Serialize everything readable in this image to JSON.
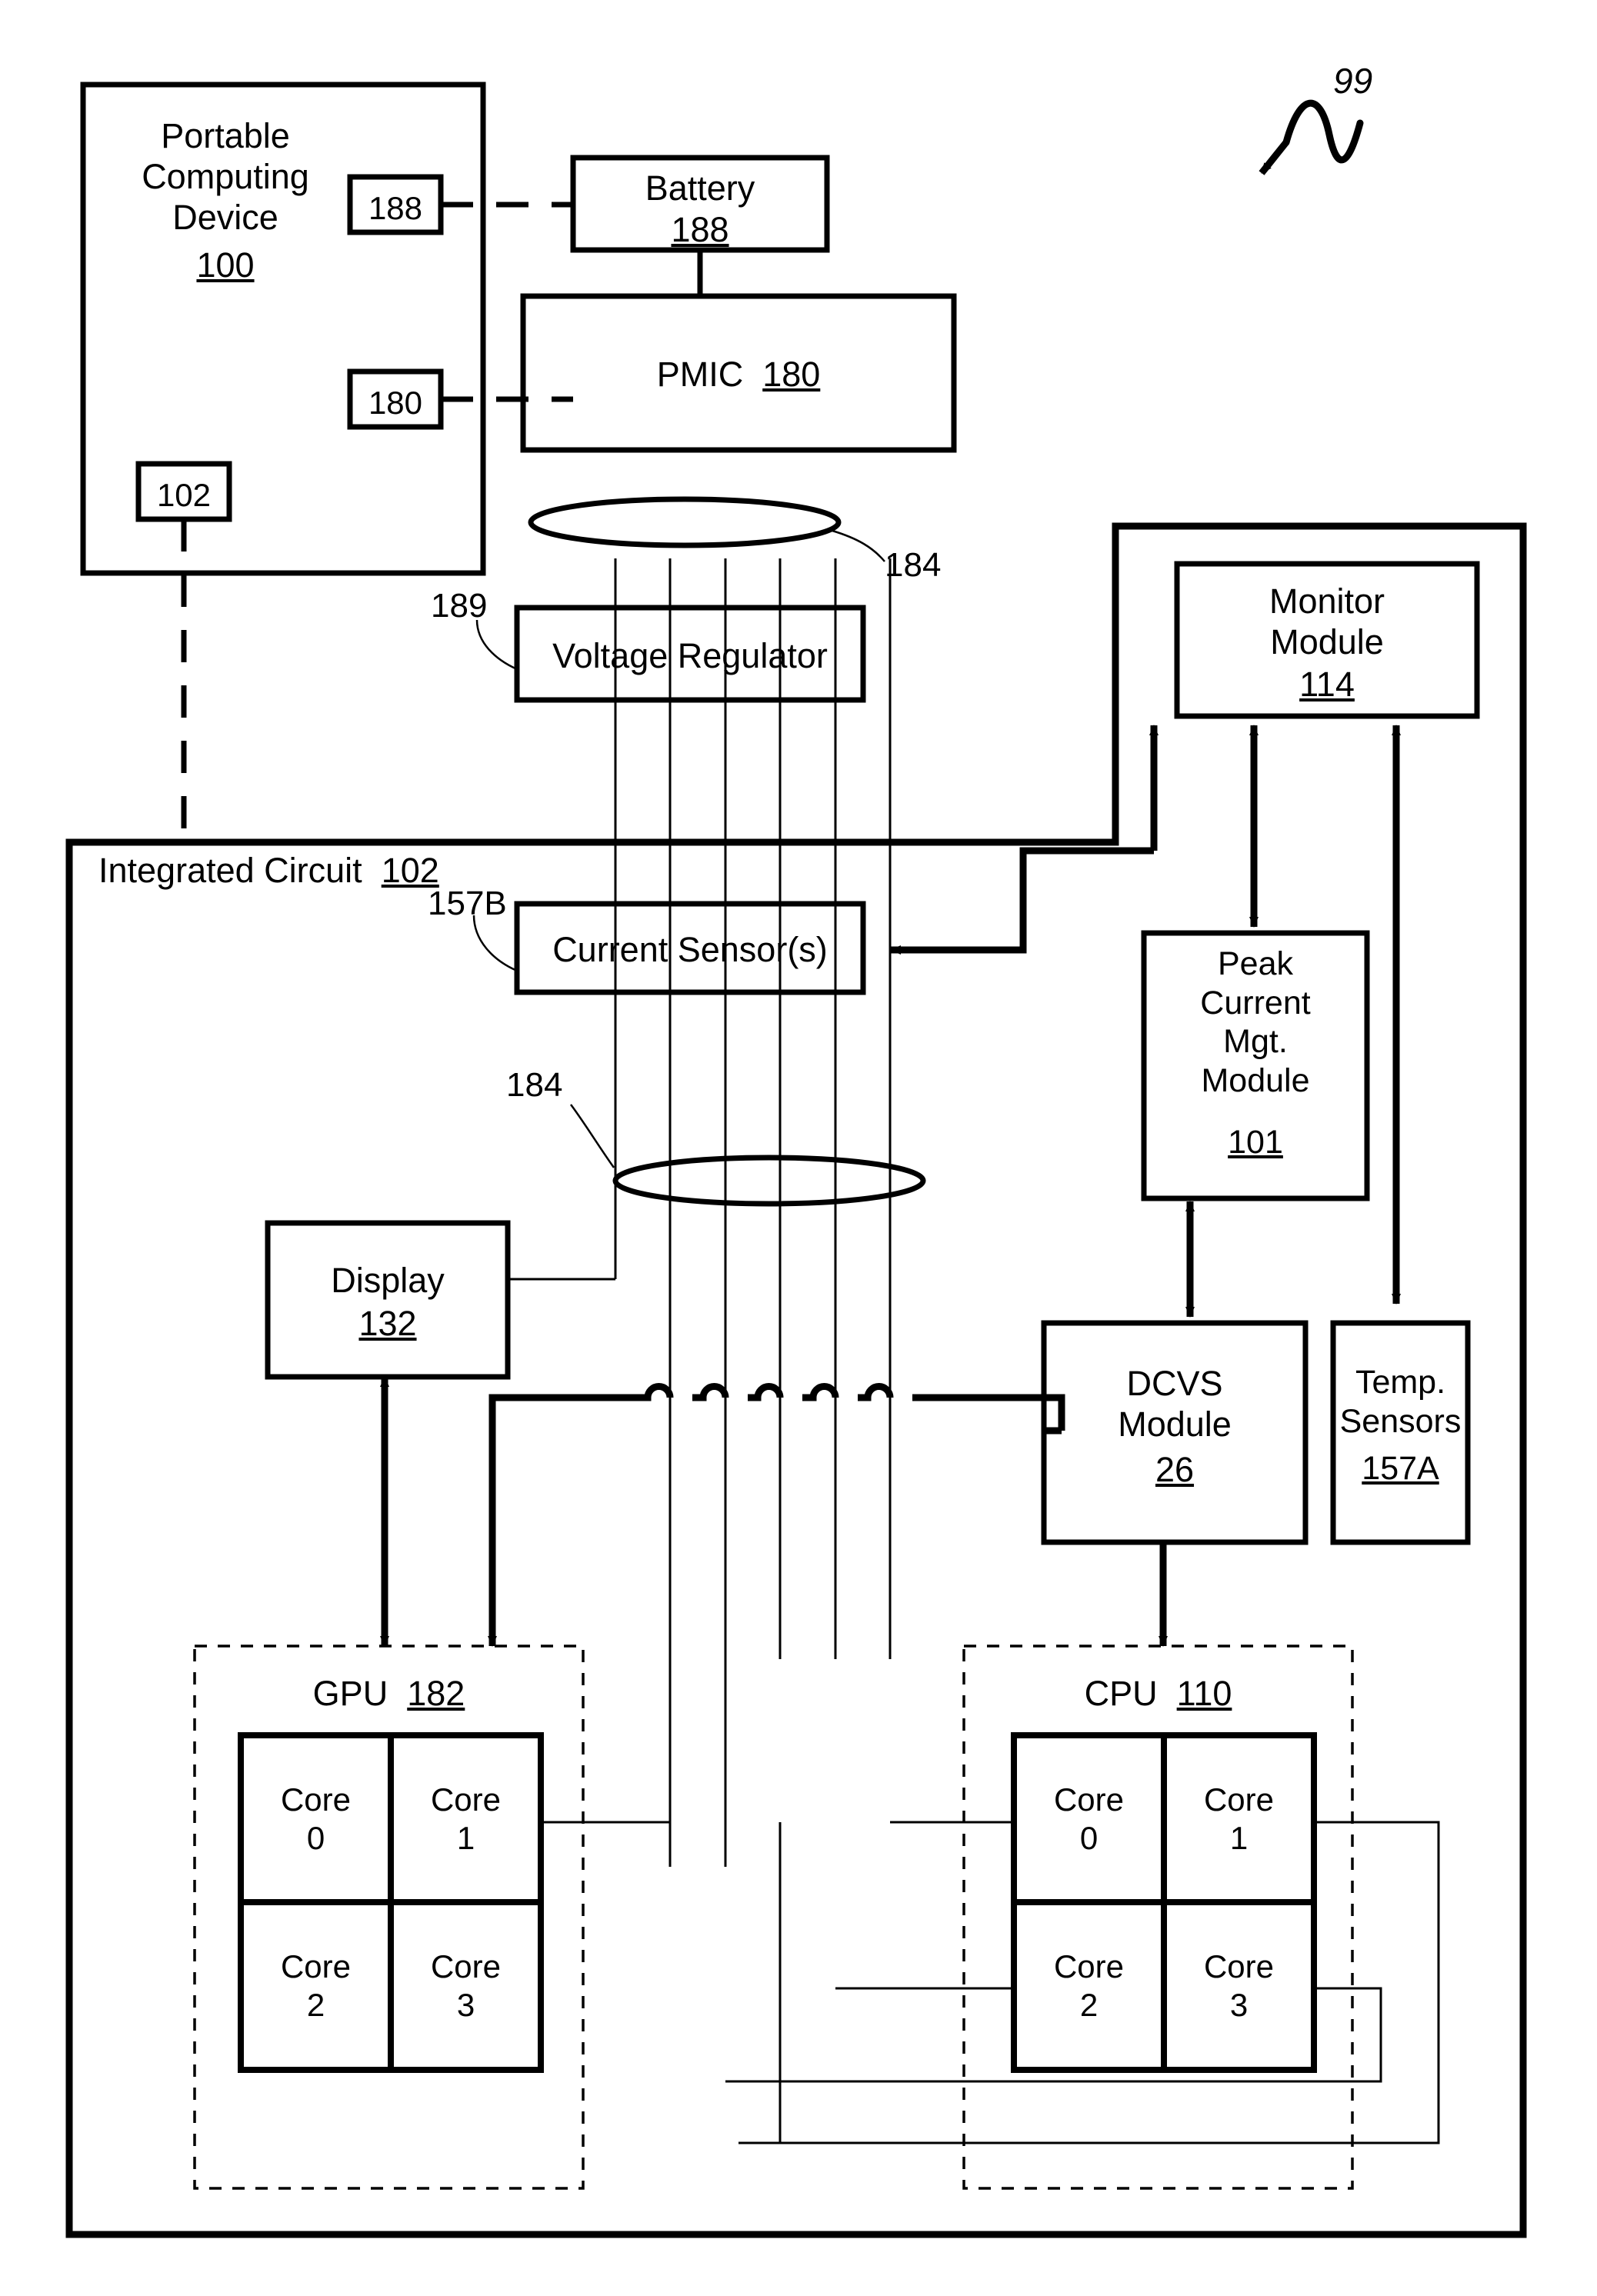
{
  "figure": {
    "figure_number": "99",
    "background_color": "#ffffff",
    "line_color": "#000000"
  },
  "blocks": {
    "portable_computing_device": {
      "title": "Portable\nComputing\nDevice",
      "ref": "100"
    },
    "pcd_port_188": {
      "label": "188"
    },
    "pcd_port_180": {
      "label": "180"
    },
    "pcd_port_102": {
      "label": "102"
    },
    "battery": {
      "title": "Battery",
      "ref": "188"
    },
    "pmic": {
      "title": "PMIC",
      "ref": "180"
    },
    "voltage_regulator": {
      "title": "Voltage Regulator",
      "ref": "189"
    },
    "integrated_circuit": {
      "title": "Integrated Circuit",
      "ref": "102"
    },
    "current_sensors": {
      "title": "Current Sensor(s)",
      "ref": "157B"
    },
    "monitor_module": {
      "title": "Monitor\nModule",
      "ref": "114"
    },
    "peak_current_mgt_module": {
      "title": "Peak\nCurrent\nMgt.\nModule",
      "ref": "101"
    },
    "dcvs_module": {
      "title": "DCVS\nModule",
      "ref": "26"
    },
    "temp_sensors": {
      "title": "Temp.\nSensors",
      "ref": "157A"
    },
    "display": {
      "title": "Display",
      "ref": "132"
    },
    "gpu": {
      "title": "GPU",
      "ref": "182"
    },
    "cpu": {
      "title": "CPU",
      "ref": "110"
    }
  },
  "bus_labels": {
    "upper_bus": "184",
    "lower_bus": "184"
  },
  "gpu_cores": [
    {
      "name": "Core",
      "index": "0"
    },
    {
      "name": "Core",
      "index": "1"
    },
    {
      "name": "Core",
      "index": "2"
    },
    {
      "name": "Core",
      "index": "3"
    }
  ],
  "cpu_cores": [
    {
      "name": "Core",
      "index": "0"
    },
    {
      "name": "Core",
      "index": "1"
    },
    {
      "name": "Core",
      "index": "2"
    },
    {
      "name": "Core",
      "index": "3"
    }
  ],
  "core_text": {
    "gpu_core0": "Core\n0",
    "gpu_core1": "Core\n1",
    "gpu_core2": "Core\n2",
    "gpu_core3": "Core\n3",
    "cpu_core0": "Core\n0",
    "cpu_core1": "Core\n1",
    "cpu_core2": "Core\n2",
    "cpu_core3": "Core\n3"
  }
}
